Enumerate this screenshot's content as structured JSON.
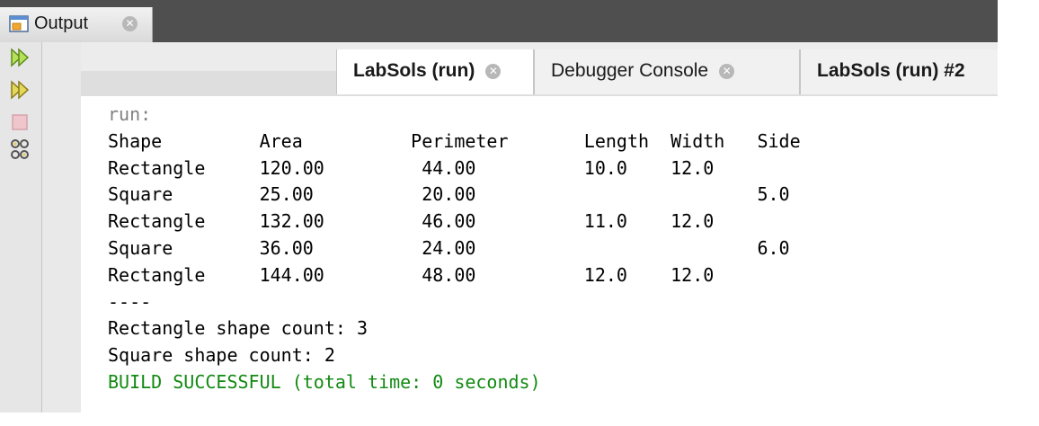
{
  "panel": {
    "title": "Output",
    "close_glyph": "✕",
    "icon": "output-window-icon"
  },
  "toolbar": {
    "icons": [
      "rerun-icon",
      "rerun-with-options-icon",
      "stop-icon",
      "settings-icon"
    ]
  },
  "tabs": [
    {
      "label": "LabSols (run)",
      "bold": true,
      "active": true,
      "close_glyph": "✕"
    },
    {
      "label": "Debugger Console",
      "bold": false,
      "active": false,
      "close_glyph": "✕"
    },
    {
      "label": "LabSols (run) #2",
      "bold": true,
      "active": false
    }
  ],
  "console": {
    "lines": [
      "run:",
      "Shape         Area          Perimeter       Length  Width   Side",
      "Rectangle     120.00         44.00          10.0    12.0",
      "Square        25.00          20.00                          5.0",
      "Rectangle     132.00         46.00          11.0    12.0",
      "Square        36.00          24.00                          6.0",
      "Rectangle     144.00         48.00          12.0    12.0",
      "----",
      "Rectangle shape count: 3",
      "Square shape count: 2",
      "BUILD SUCCESSFUL (total time: 0 seconds)"
    ],
    "colors": {
      "run": "#808080",
      "normal": "#000000",
      "build": "#128a12"
    }
  }
}
